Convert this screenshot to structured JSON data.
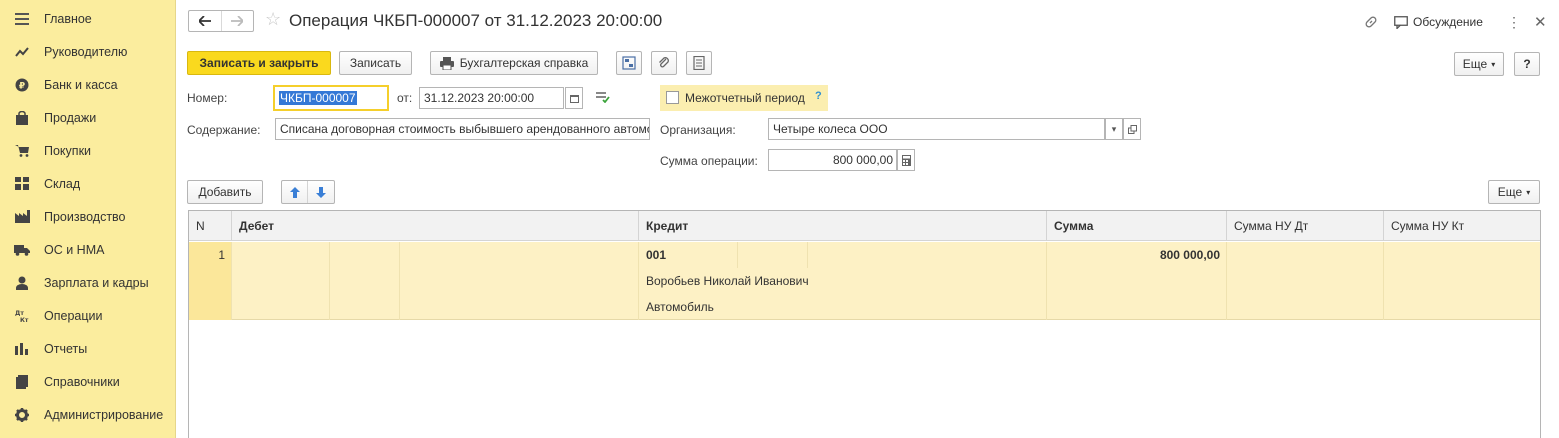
{
  "sidebar": {
    "items": [
      {
        "label": "Главное",
        "icon": "menu-icon"
      },
      {
        "label": "Руководителю",
        "icon": "trend-icon"
      },
      {
        "label": "Банк и касса",
        "icon": "ruble-icon"
      },
      {
        "label": "Продажи",
        "icon": "bag-icon"
      },
      {
        "label": "Покупки",
        "icon": "cart-icon"
      },
      {
        "label": "Склад",
        "icon": "warehouse-icon"
      },
      {
        "label": "Производство",
        "icon": "factory-icon"
      },
      {
        "label": "ОС и НМА",
        "icon": "truck-icon"
      },
      {
        "label": "Зарплата и кадры",
        "icon": "person-icon"
      },
      {
        "label": "Операции",
        "icon": "dt-kt-icon"
      },
      {
        "label": "Отчеты",
        "icon": "bar-chart-icon"
      },
      {
        "label": "Справочники",
        "icon": "book-icon"
      },
      {
        "label": "Администрирование",
        "icon": "gear-icon"
      }
    ]
  },
  "header": {
    "title": "Операция ЧКБП-000007 от 31.12.2023 20:00:00",
    "discussion_label": "Обсуждение"
  },
  "toolbar": {
    "save_close_label": "Записать и закрыть",
    "save_label": "Записать",
    "accounting_ref_label": "Бухгалтерская справка",
    "more_label": "Еще",
    "help_label": "?"
  },
  "form": {
    "number_label": "Номер:",
    "number_value": "ЧКБП-000007",
    "date_label": "от:",
    "date_value": "31.12.2023 20:00:00",
    "interperiod_label": "Межотчетный период",
    "interperiod_help": "?",
    "content_label": "Содержание:",
    "content_value": "Списана договорная стоимость выбывшего арендованного автомобиля",
    "org_label": "Организация:",
    "org_value": "Четыре колеса ООО",
    "sum_label": "Сумма операции:",
    "sum_value": "800 000,00"
  },
  "table_toolbar": {
    "add_label": "Добавить",
    "more_label": "Еще"
  },
  "table": {
    "columns": [
      "N",
      "Дебет",
      "Кредит",
      "Сумма",
      "Сумма НУ Дт",
      "Сумма НУ Кт"
    ],
    "rows": [
      {
        "n": "1",
        "debit": "",
        "credit_account": "001",
        "credit_sub1": "Воробьев Николай Иванович",
        "credit_sub2": "Автомобиль",
        "sum": "800 000,00",
        "sum_nu_dt": "",
        "sum_nu_kt": ""
      }
    ]
  },
  "colors": {
    "sidebar_bg": "#fbed9e",
    "primary_button": "#fad91e",
    "selected_row": "#fdf1c5"
  }
}
